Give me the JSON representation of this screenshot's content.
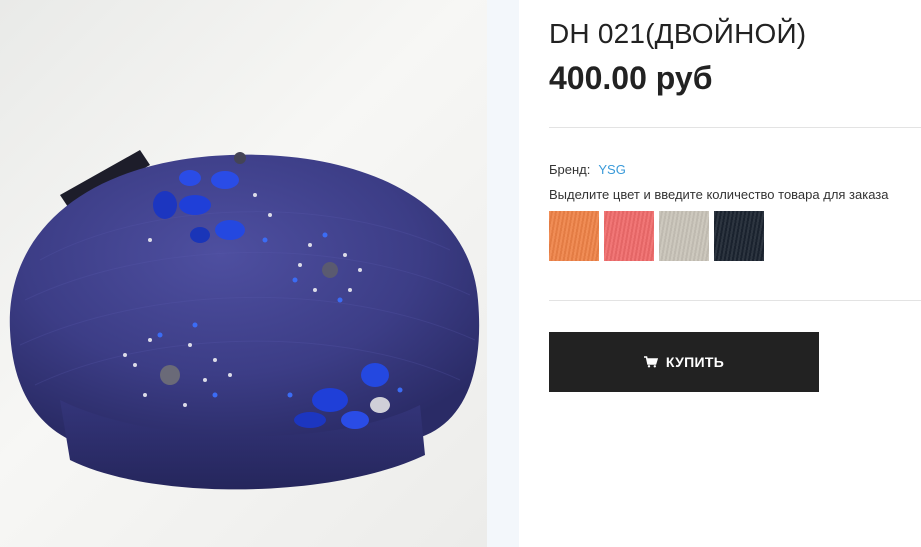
{
  "product": {
    "title": "DH 021(ДВОЙНОЙ)",
    "price": "400.00 руб",
    "image_icon": "knitted-beret-photo"
  },
  "brand": {
    "label": "Бренд:",
    "value": "YSG"
  },
  "colors": {
    "instruction": "Выделите цвет и введите количество товара для заказа",
    "swatches": [
      {
        "name": "orange",
        "color": "#ef8348"
      },
      {
        "name": "coral",
        "color": "#f06b6b"
      },
      {
        "name": "beige",
        "color": "#c9c4b9"
      },
      {
        "name": "navy",
        "color": "#1b2430"
      }
    ]
  },
  "buy_button": {
    "label": "КУПИТЬ",
    "icon": "cart-icon"
  }
}
